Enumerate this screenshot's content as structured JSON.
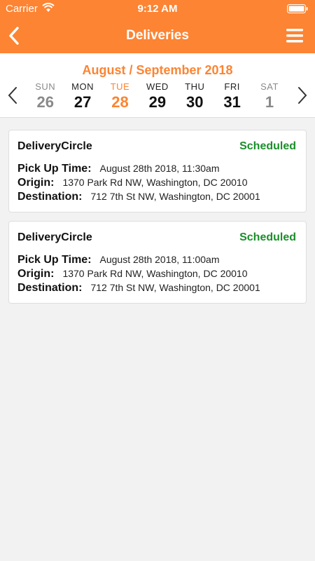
{
  "status_bar": {
    "carrier": "Carrier",
    "time": "9:12 AM"
  },
  "nav": {
    "title": "Deliveries"
  },
  "calendar": {
    "month_label": "August / September 2018",
    "days": [
      {
        "name": "SUN",
        "number": "26"
      },
      {
        "name": "MON",
        "number": "27"
      },
      {
        "name": "TUE",
        "number": "28"
      },
      {
        "name": "WED",
        "number": "29"
      },
      {
        "name": "THU",
        "number": "30"
      },
      {
        "name": "FRI",
        "number": "31"
      },
      {
        "name": "SAT",
        "number": "1"
      }
    ]
  },
  "labels": {
    "pickup": "Pick Up Time:",
    "origin": "Origin:",
    "destination": "Destination:"
  },
  "deliveries": [
    {
      "company": "DeliveryCircle",
      "status": "Scheduled",
      "pickup_time": "August 28th 2018, 11:30am",
      "origin": "1370 Park Rd NW, Washington, DC 20010",
      "destination": "712 7th St NW, Washington, DC 20001"
    },
    {
      "company": "DeliveryCircle",
      "status": "Scheduled",
      "pickup_time": "August 28th 2018, 11:00am",
      "origin": "1370 Park Rd NW, Washington, DC 20010",
      "destination": "712 7th St NW, Washington, DC 20001"
    }
  ],
  "colors": {
    "accent": "#fc8433",
    "status_green": "#1a8f2a",
    "background": "#f2f2f2"
  },
  "icons": {
    "back": "chevron-left-icon",
    "menu": "hamburger-icon",
    "prev": "chevron-left-icon",
    "next": "chevron-right-icon",
    "wifi": "wifi-icon",
    "battery": "battery-icon"
  }
}
